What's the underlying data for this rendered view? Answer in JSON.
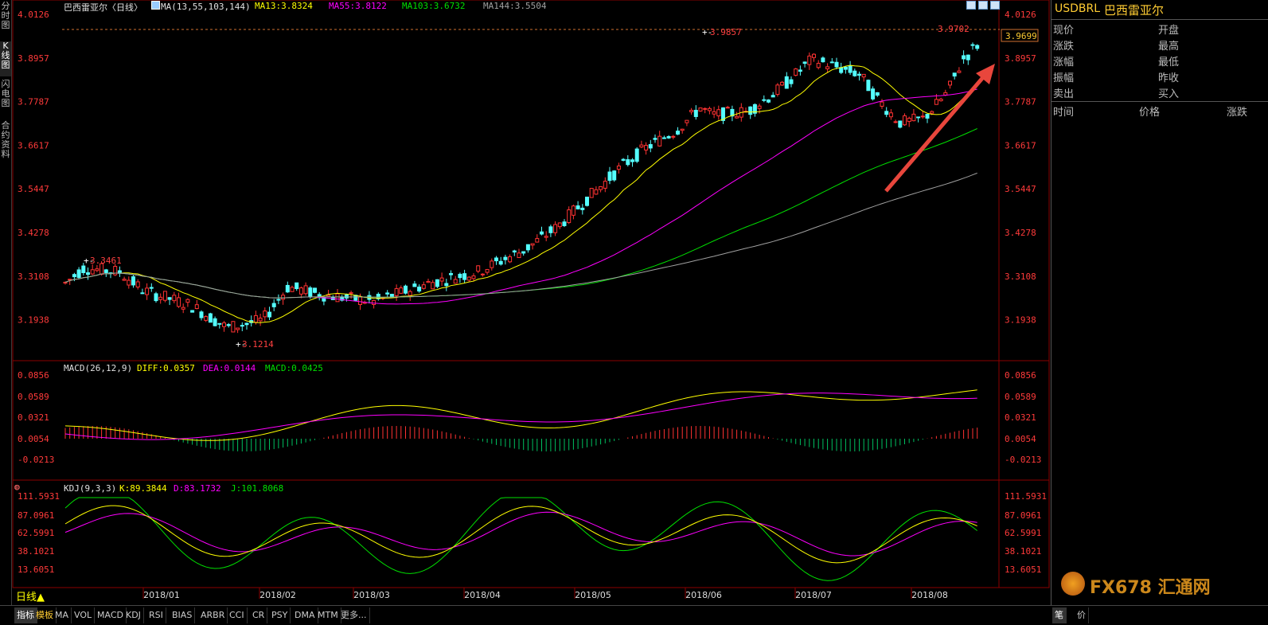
{
  "header": {
    "title": "巴西雷亚尔〈日线〉",
    "ma_label": "MA(13,55,103,144)",
    "ma13": "MA13:3.8324",
    "ma55": "MA55:3.8122",
    "ma103": "MA103:3.6732",
    "ma144": "MA144:3.5504"
  },
  "left_nav": [
    "分时图",
    "K线图",
    "闪电图",
    "合约资料"
  ],
  "price_axis": [
    "4.0126",
    "3.8957",
    "3.7787",
    "3.6617",
    "3.5447",
    "3.4278",
    "3.3108",
    "3.1938"
  ],
  "annotations": {
    "high1": "3.3461",
    "low": "3.1214",
    "high2": "3.9857",
    "last_high": "3.9702",
    "current_price": "3.9699"
  },
  "macd": {
    "label": "MACD(26,12,9)",
    "diff": "DIFF:0.0357",
    "dea": "DEA:0.0144",
    "macd": "MACD:0.0425",
    "axis": [
      "0.0856",
      "0.0589",
      "0.0321",
      "0.0054",
      "-0.0213"
    ]
  },
  "kdj": {
    "label": "KDJ(9,3,3)",
    "k": "K:89.3844",
    "d": "D:83.1732",
    "j": "J:101.8068",
    "axis": [
      "111.5931",
      "87.0961",
      "62.5991",
      "38.1021",
      "13.6051"
    ]
  },
  "time_axis": [
    "2018/01",
    "2018/02",
    "2018/03",
    "2018/04",
    "2018/05",
    "2018/06",
    "2018/07",
    "2018/08"
  ],
  "period_label": "日线▲",
  "quote_panel": {
    "symbol": "USDBRL",
    "name": "巴西雷亚尔",
    "rows": [
      [
        "现价",
        "开盘"
      ],
      [
        "涨跌",
        "最高"
      ],
      [
        "涨幅",
        "最低"
      ],
      [
        "振幅",
        "昨收"
      ],
      [
        "卖出",
        "买入"
      ]
    ],
    "columns": [
      "时间",
      "价格",
      "涨跌"
    ]
  },
  "bottom_tabs": [
    "指标",
    "模板",
    "MA",
    "VOL",
    "MACD",
    "KDJ",
    "RSI",
    "BIAS",
    "ARBR",
    "CCI",
    "CR",
    "PSY",
    "DMA",
    "MTM",
    "更多..."
  ],
  "bottom_right_tabs": [
    "笔",
    "价"
  ],
  "watermark": "FX678 汇通网",
  "colors": {
    "up": "#ff3232",
    "down": "#54ffff",
    "ma13": "#ffff00",
    "ma55": "#ff00ff",
    "ma103": "#00e000",
    "ma144": "#a0a0a0",
    "axis_text": "#ff3a3a",
    "arrow": "#e8463c"
  }
}
